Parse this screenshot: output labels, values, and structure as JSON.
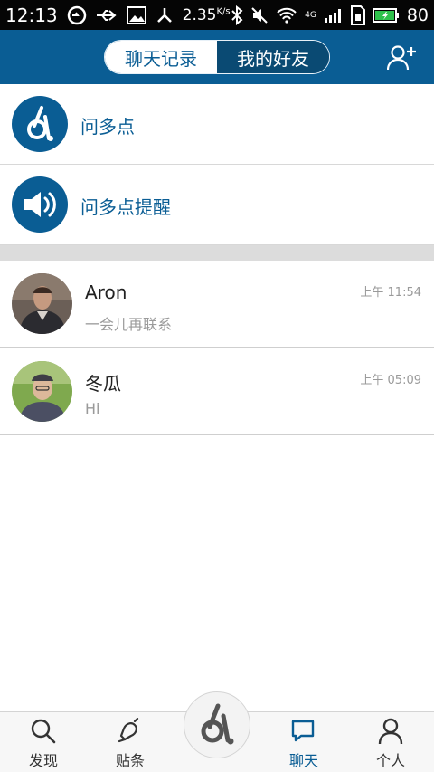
{
  "status_bar": {
    "time": "12:13",
    "speed": "2.35",
    "speed_unit": "K/s",
    "battery_level": "80",
    "network": "4G"
  },
  "header": {
    "tabs": [
      {
        "label": "聊天记录",
        "active": true
      },
      {
        "label": "我的好友",
        "active": false
      }
    ],
    "add_friend_icon": "add-user-icon"
  },
  "system_items": [
    {
      "label": "问多点",
      "icon": "brand-logo-icon"
    },
    {
      "label": "问多点提醒",
      "icon": "speaker-icon"
    }
  ],
  "chats": [
    {
      "name": "Aron",
      "message": "一会儿再联系",
      "time": "上午 11:54"
    },
    {
      "name": "冬瓜",
      "message": "Hi",
      "time": "上午 05:09"
    }
  ],
  "bottom_nav": [
    {
      "label": "发现",
      "icon": "search-icon",
      "active": false
    },
    {
      "label": "贴条",
      "icon": "bell-icon",
      "active": false
    },
    {
      "label": "聊天",
      "icon": "chat-bubble-icon",
      "active": true
    },
    {
      "label": "个人",
      "icon": "person-icon",
      "active": false
    }
  ],
  "colors": {
    "brand": "#0a5d94",
    "status_bar": "#050505",
    "divider": "#dcdcdc"
  }
}
